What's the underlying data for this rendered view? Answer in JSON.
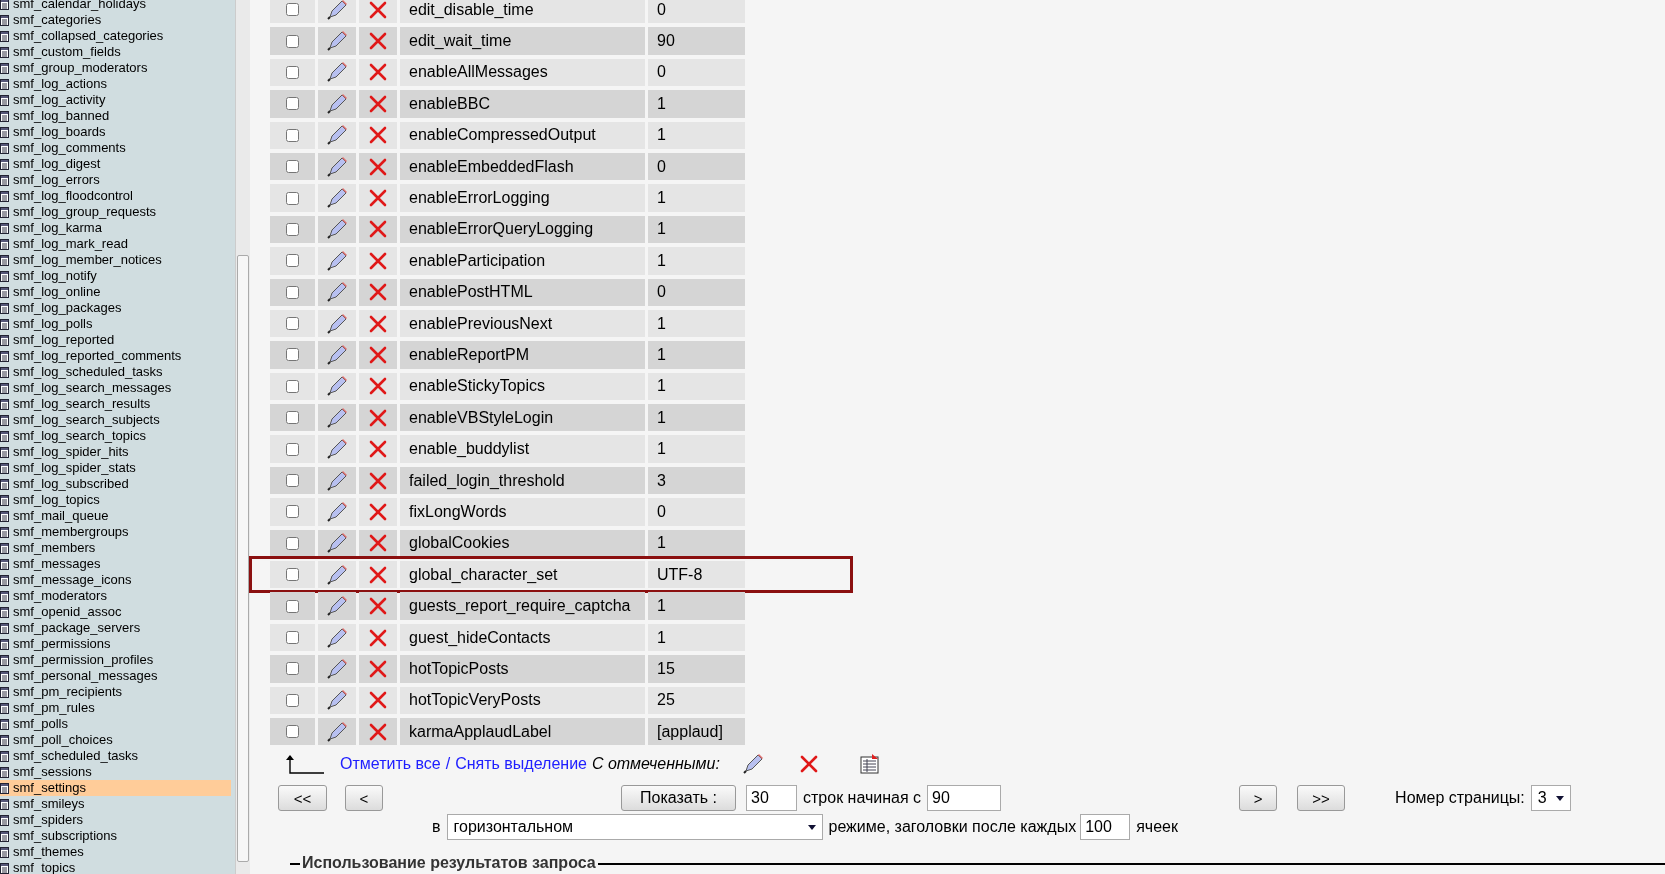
{
  "sidebar": {
    "items": [
      {
        "label": "smf_calendar_holidays",
        "selected": false
      },
      {
        "label": "smf_categories",
        "selected": false
      },
      {
        "label": "smf_collapsed_categories",
        "selected": false
      },
      {
        "label": "smf_custom_fields",
        "selected": false
      },
      {
        "label": "smf_group_moderators",
        "selected": false
      },
      {
        "label": "smf_log_actions",
        "selected": false
      },
      {
        "label": "smf_log_activity",
        "selected": false
      },
      {
        "label": "smf_log_banned",
        "selected": false
      },
      {
        "label": "smf_log_boards",
        "selected": false
      },
      {
        "label": "smf_log_comments",
        "selected": false
      },
      {
        "label": "smf_log_digest",
        "selected": false
      },
      {
        "label": "smf_log_errors",
        "selected": false
      },
      {
        "label": "smf_log_floodcontrol",
        "selected": false
      },
      {
        "label": "smf_log_group_requests",
        "selected": false
      },
      {
        "label": "smf_log_karma",
        "selected": false
      },
      {
        "label": "smf_log_mark_read",
        "selected": false
      },
      {
        "label": "smf_log_member_notices",
        "selected": false
      },
      {
        "label": "smf_log_notify",
        "selected": false
      },
      {
        "label": "smf_log_online",
        "selected": false
      },
      {
        "label": "smf_log_packages",
        "selected": false
      },
      {
        "label": "smf_log_polls",
        "selected": false
      },
      {
        "label": "smf_log_reported",
        "selected": false
      },
      {
        "label": "smf_log_reported_comments",
        "selected": false
      },
      {
        "label": "smf_log_scheduled_tasks",
        "selected": false
      },
      {
        "label": "smf_log_search_messages",
        "selected": false
      },
      {
        "label": "smf_log_search_results",
        "selected": false
      },
      {
        "label": "smf_log_search_subjects",
        "selected": false
      },
      {
        "label": "smf_log_search_topics",
        "selected": false
      },
      {
        "label": "smf_log_spider_hits",
        "selected": false
      },
      {
        "label": "smf_log_spider_stats",
        "selected": false
      },
      {
        "label": "smf_log_subscribed",
        "selected": false
      },
      {
        "label": "smf_log_topics",
        "selected": false
      },
      {
        "label": "smf_mail_queue",
        "selected": false
      },
      {
        "label": "smf_membergroups",
        "selected": false
      },
      {
        "label": "smf_members",
        "selected": false
      },
      {
        "label": "smf_messages",
        "selected": false
      },
      {
        "label": "smf_message_icons",
        "selected": false
      },
      {
        "label": "smf_moderators",
        "selected": false
      },
      {
        "label": "smf_openid_assoc",
        "selected": false
      },
      {
        "label": "smf_package_servers",
        "selected": false
      },
      {
        "label": "smf_permissions",
        "selected": false
      },
      {
        "label": "smf_permission_profiles",
        "selected": false
      },
      {
        "label": "smf_personal_messages",
        "selected": false
      },
      {
        "label": "smf_pm_recipients",
        "selected": false
      },
      {
        "label": "smf_pm_rules",
        "selected": false
      },
      {
        "label": "smf_polls",
        "selected": false
      },
      {
        "label": "smf_poll_choices",
        "selected": false
      },
      {
        "label": "smf_scheduled_tasks",
        "selected": false
      },
      {
        "label": "smf_sessions",
        "selected": false
      },
      {
        "label": "smf_settings",
        "selected": true
      },
      {
        "label": "smf_smileys",
        "selected": false
      },
      {
        "label": "smf_spiders",
        "selected": false
      },
      {
        "label": "smf_subscriptions",
        "selected": false
      },
      {
        "label": "smf_themes",
        "selected": false
      },
      {
        "label": "smf_topics",
        "selected": false
      }
    ]
  },
  "table": {
    "rows": [
      {
        "variable": "edit_disable_time",
        "value": "0",
        "checked": false,
        "highlighted": false
      },
      {
        "variable": "edit_wait_time",
        "value": "90",
        "checked": false,
        "highlighted": false
      },
      {
        "variable": "enableAllMessages",
        "value": "0",
        "checked": false,
        "highlighted": false
      },
      {
        "variable": "enableBBC",
        "value": "1",
        "checked": false,
        "highlighted": false
      },
      {
        "variable": "enableCompressedOutput",
        "value": "1",
        "checked": false,
        "highlighted": false
      },
      {
        "variable": "enableEmbeddedFlash",
        "value": "0",
        "checked": false,
        "highlighted": false
      },
      {
        "variable": "enableErrorLogging",
        "value": "1",
        "checked": false,
        "highlighted": false
      },
      {
        "variable": "enableErrorQueryLogging",
        "value": "1",
        "checked": false,
        "highlighted": false
      },
      {
        "variable": "enableParticipation",
        "value": "1",
        "checked": false,
        "highlighted": false
      },
      {
        "variable": "enablePostHTML",
        "value": "0",
        "checked": false,
        "highlighted": false
      },
      {
        "variable": "enablePreviousNext",
        "value": "1",
        "checked": false,
        "highlighted": false
      },
      {
        "variable": "enableReportPM",
        "value": "1",
        "checked": false,
        "highlighted": false
      },
      {
        "variable": "enableStickyTopics",
        "value": "1",
        "checked": false,
        "highlighted": false
      },
      {
        "variable": "enableVBStyleLogin",
        "value": "1",
        "checked": false,
        "highlighted": false
      },
      {
        "variable": "enable_buddylist",
        "value": "1",
        "checked": false,
        "highlighted": false
      },
      {
        "variable": "failed_login_threshold",
        "value": "3",
        "checked": false,
        "highlighted": false
      },
      {
        "variable": "fixLongWords",
        "value": "0",
        "checked": false,
        "highlighted": false
      },
      {
        "variable": "globalCookies",
        "value": "1",
        "checked": false,
        "highlighted": false
      },
      {
        "variable": "global_character_set",
        "value": "UTF-8",
        "checked": false,
        "highlighted": true
      },
      {
        "variable": "guests_report_require_captcha",
        "value": "1",
        "checked": false,
        "highlighted": false
      },
      {
        "variable": "guest_hideContacts",
        "value": "1",
        "checked": false,
        "highlighted": false
      },
      {
        "variable": "hotTopicPosts",
        "value": "15",
        "checked": false,
        "highlighted": false
      },
      {
        "variable": "hotTopicVeryPosts",
        "value": "25",
        "checked": false,
        "highlighted": false
      },
      {
        "variable": "karmaApplaudLabel",
        "value": "[applaud]",
        "checked": false,
        "highlighted": false
      }
    ]
  },
  "selection": {
    "check_all": "Отметить все",
    "separator": "/",
    "uncheck_all": "Снять выделение",
    "with_selected": "С отмеченными:"
  },
  "navigation": {
    "first": "<<",
    "prev": "<",
    "show_button": "Показать :",
    "rows_count": "30",
    "rows_from_label": "строк начиная с",
    "start_row": "90",
    "next": ">",
    "last": ">>",
    "page_label": "Номер страницы:",
    "page": "3",
    "mode_prefix": "в",
    "mode": "горизонтальном",
    "mode_suffix": "режиме, заголовки после каждых",
    "repeat_cells": "100",
    "cells_label": "ячеек"
  },
  "query_results": {
    "legend": "Использование результатов запроса"
  }
}
